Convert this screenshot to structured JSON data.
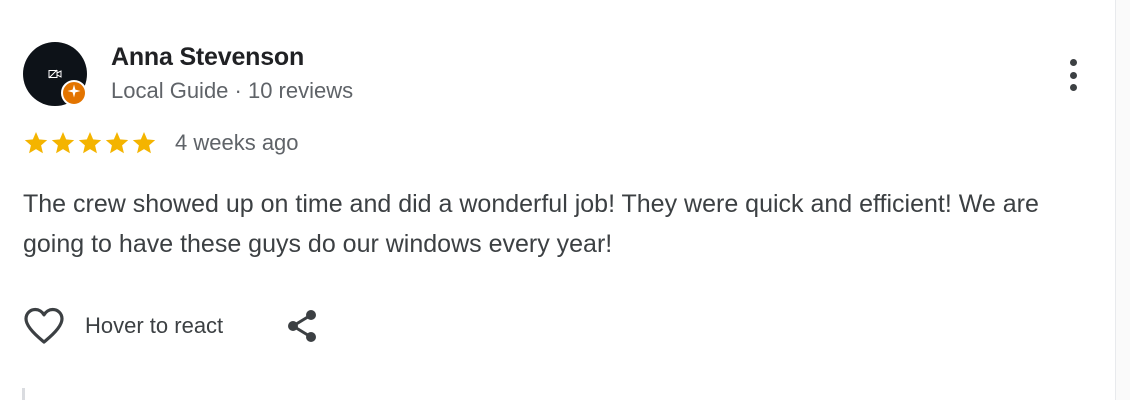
{
  "reviewer": {
    "name": "Anna Stevenson",
    "meta": "Local Guide · 10 reviews",
    "avatar_icon": "video-off-icon",
    "badge_icon": "local-guide-star-icon",
    "badge_color": "#e37400"
  },
  "review": {
    "rating": 5,
    "max_rating": 5,
    "star_color": "#f4b400",
    "date": "4 weeks ago",
    "text": "The crew showed up on time and did a wonderful job! They were quick and efficient! We are going to have these guys do our windows every year!"
  },
  "actions": {
    "react_label": "Hover to react",
    "like_icon": "heart-outline-icon",
    "share_icon": "share-icon",
    "more_icon": "more-vertical-icon"
  }
}
